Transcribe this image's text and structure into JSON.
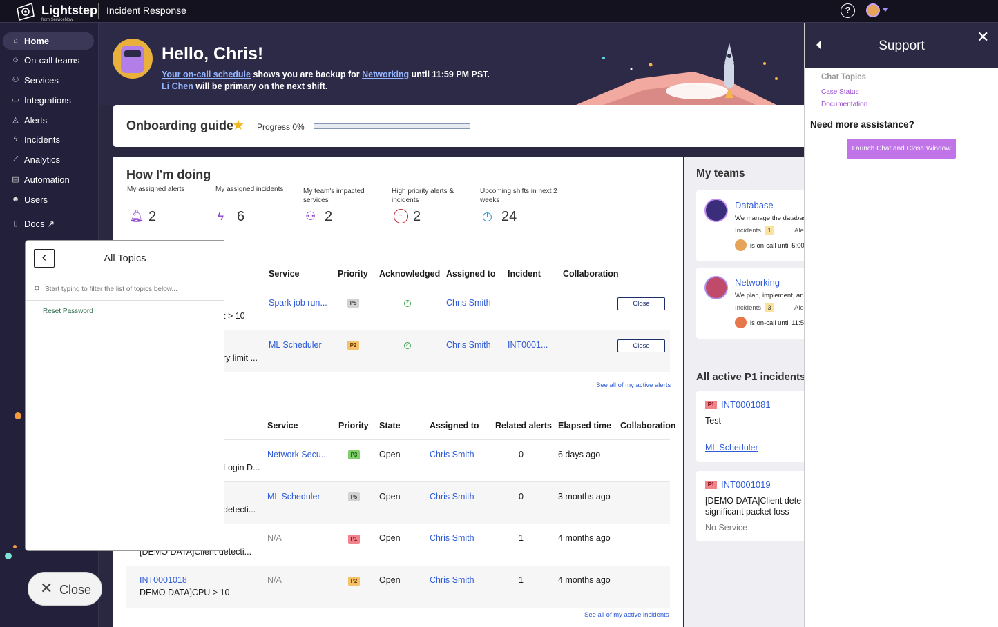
{
  "header": {
    "logo_name": "Lightstep",
    "logo_sub": "from ServiceNow",
    "app_title": "Incident Response",
    "help_icon": "help-icon",
    "avatar_icon": "user-avatar"
  },
  "sidebar": {
    "items": [
      {
        "label": "Home",
        "icon": "⌂",
        "active": true
      },
      {
        "label": "On-call teams",
        "icon": "☺"
      },
      {
        "label": "Services",
        "icon": "⚇"
      },
      {
        "label": "Integrations",
        "icon": "▭"
      },
      {
        "label": "Alerts",
        "icon": "◬"
      },
      {
        "label": "Incidents",
        "icon": "ϟ"
      },
      {
        "label": "Analytics",
        "icon": "⟋"
      },
      {
        "label": "Automation",
        "icon": "▤"
      },
      {
        "label": "Users",
        "icon": "☻"
      },
      {
        "label": "Docs ↗",
        "icon": "▯"
      }
    ]
  },
  "hero": {
    "greeting": "Hello, Chris!",
    "schedule_link": "Your on-call schedule",
    "text1": " shows you are backup for ",
    "team_link": "Networking",
    "text2": " until 11:59 PM PST.",
    "person_link": "Li Chen",
    "text3": " will be primary on the next shift."
  },
  "onboarding": {
    "title": "Onboarding guide",
    "star": "★",
    "progress_label": "Progress 0%",
    "progress": 0
  },
  "howdoing": {
    "title": "How I'm doing",
    "stats": [
      {
        "label": "My assigned alerts",
        "value": "2",
        "icon": "🔔︎",
        "color": "#8a3fd1"
      },
      {
        "label": "My assigned incidents",
        "value": "6",
        "icon": "ϟ",
        "color": "#8a3fd1"
      },
      {
        "label": "My team's impacted services",
        "value": "2",
        "icon": "⚇",
        "color": "#8a3fd1"
      },
      {
        "label": "High priority alerts & incidents",
        "value": "2",
        "icon": "↑",
        "color": "#c0202a"
      },
      {
        "label": "Upcoming shifts in next 2 weeks",
        "value": "24",
        "icon": "◷",
        "color": "#1f8fd0"
      }
    ]
  },
  "alerts": {
    "headers": [
      "Service",
      "Priority",
      "Acknowledged",
      "Assigned to",
      "Incident",
      "Collaboration"
    ],
    "rows": [
      {
        "name": "t > 10",
        "service": "Spark job run...",
        "priority": "P5",
        "assigned": "Chris Smith",
        "incident": "",
        "close": "Close"
      },
      {
        "name": "ry limit ...",
        "service": "ML Scheduler",
        "priority": "P2",
        "assigned": "Chris Smith",
        "incident": "INT0001...",
        "close": "Close"
      }
    ],
    "see_all": "See all of my active alerts"
  },
  "incidents": {
    "headers": [
      "Service",
      "Priority",
      "State",
      "Assigned to",
      "Related alerts",
      "Elapsed time",
      "Collaboration"
    ],
    "rows": [
      {
        "id": "",
        "name": "Login D...",
        "service": "Network Secu...",
        "priority": "P3",
        "state": "Open",
        "assigned": "Chris Smith",
        "related": "0",
        "elapsed": "6 days ago"
      },
      {
        "id": "",
        "name": "detecti...",
        "service": "ML Scheduler",
        "priority": "P5",
        "state": "Open",
        "assigned": "Chris Smith",
        "related": "0",
        "elapsed": "3 months ago"
      },
      {
        "id": "",
        "name": "[DEMO DATA]Client detecti...",
        "service": "N/A",
        "priority": "P1",
        "state": "Open",
        "assigned": "Chris Smith",
        "related": "1",
        "elapsed": "4 months ago"
      },
      {
        "id": "INT0001018",
        "name": "DEMO DATA]CPU > 10",
        "service": "N/A",
        "priority": "P2",
        "state": "Open",
        "assigned": "Chris Smith",
        "related": "1",
        "elapsed": "4 months ago"
      }
    ],
    "see_all": "See all of my active incidents"
  },
  "my_teams": {
    "title": "My teams",
    "teams": [
      {
        "name": "Database",
        "desc": "We manage the databas",
        "incidents_label": "Incidents",
        "incidents": "1",
        "alerts_label": "Alerts",
        "oncall": "is on-call until 5:00"
      },
      {
        "name": "Networking",
        "desc": "We plan, implement, and",
        "incidents_label": "Incidents",
        "incidents": "3",
        "alerts_label": "Alerts",
        "oncall": "is on-call until 11:5"
      }
    ]
  },
  "p1": {
    "title": "All active P1 incidents (",
    "items": [
      {
        "badge": "P1",
        "id": "INT0001081",
        "title": "Test",
        "service": "ML Scheduler"
      },
      {
        "badge": "P1",
        "id": "INT0001019",
        "title": "[DEMO DATA]Client dete significant packet loss",
        "service": "No Service"
      }
    ]
  },
  "support": {
    "title": "Support",
    "close_icon": "✕",
    "chat_topics": "Chat Topics",
    "links": [
      "Case Status",
      "Documentation"
    ],
    "need_more": "Need more assistance?",
    "launch": "Launch Chat and Close Window"
  },
  "topics": {
    "title": "All Topics",
    "back": "‹",
    "placeholder": "Start typing to filter the list of topics below...",
    "items": [
      "Reset Password"
    ]
  },
  "close_button": {
    "icon": "✕",
    "label": "Close"
  }
}
